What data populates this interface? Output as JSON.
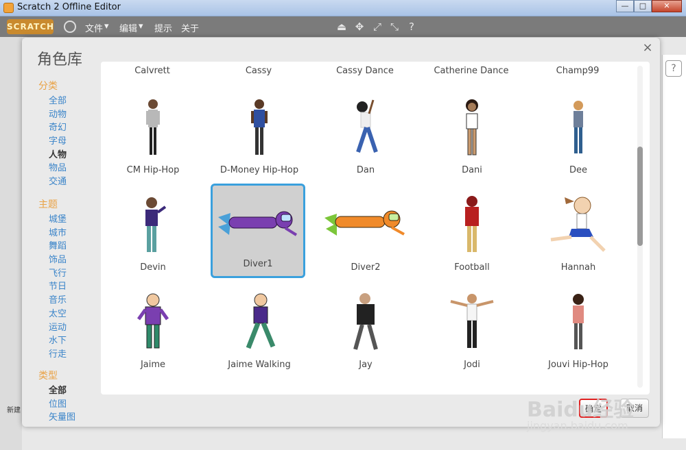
{
  "window": {
    "title": "Scratch 2 Offline Editor"
  },
  "menubar": {
    "logo": "SCRATCH",
    "file": "文件",
    "edit": "编辑",
    "tips": "提示",
    "about": "关于"
  },
  "dialog": {
    "title": "角色库",
    "close": "×",
    "ok_label": "确定",
    "cancel_label": "取消"
  },
  "sidebar": {
    "category_head": "分类",
    "categories": [
      "全部",
      "动物",
      "奇幻",
      "字母",
      "人物",
      "物品",
      "交通"
    ],
    "theme_head": "主题",
    "themes": [
      "城堡",
      "城市",
      "舞蹈",
      "饰品",
      "飞行",
      "节日",
      "音乐",
      "太空",
      "运动",
      "水下",
      "行走"
    ],
    "type_head": "类型",
    "types": [
      "全部",
      "位图",
      "矢量图"
    ]
  },
  "top_row": [
    "Calvrett",
    "Cassy",
    "Cassy Dance",
    "Catherine Dance",
    "Champ99"
  ],
  "sprites": [
    [
      "CM Hip-Hop",
      "D-Money Hip-Hop",
      "Dan",
      "Dani",
      "Dee"
    ],
    [
      "Devin",
      "Diver1",
      "Diver2",
      "Football",
      "Hannah"
    ],
    [
      "Jaime",
      "Jaime Walking",
      "Jay",
      "Jodi",
      "Jouvi Hip-Hop"
    ]
  ],
  "bottom_left": "新建",
  "watermark": {
    "line1": "Baidu经验",
    "line2": "jingyan.baidu.com"
  },
  "colors": {
    "accent": "#3aa0dd",
    "category_head": "#e9a245",
    "link": "#3a84c9"
  }
}
